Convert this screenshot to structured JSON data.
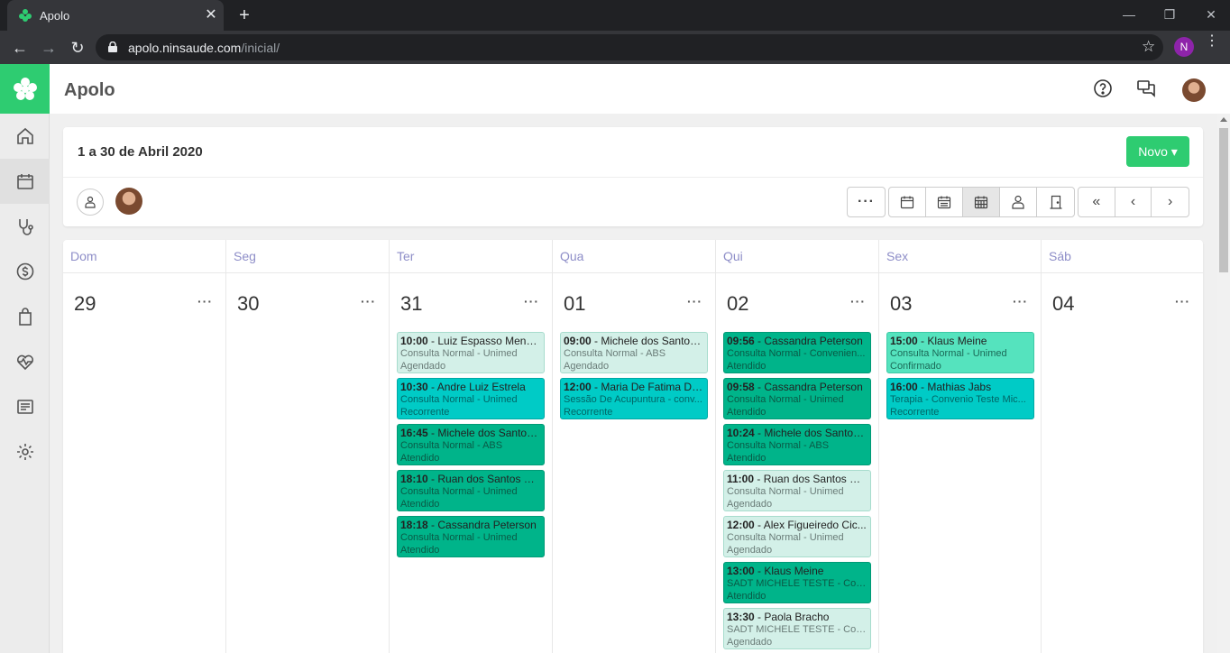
{
  "browser": {
    "tab_title": "Apolo",
    "url_host": "apolo.ninsaude.com",
    "url_path": "/inicial/",
    "profile_initial": "N"
  },
  "app": {
    "name": "Apolo",
    "brand_color": "#2ecc71"
  },
  "sidebar": {
    "items": [
      {
        "icon": "home-icon",
        "active": false
      },
      {
        "icon": "calendar-icon",
        "active": true
      },
      {
        "icon": "stethoscope-icon",
        "active": false
      },
      {
        "icon": "dollar-icon",
        "active": false
      },
      {
        "icon": "bag-icon",
        "active": false
      },
      {
        "icon": "heartbeat-icon",
        "active": false
      },
      {
        "icon": "report-icon",
        "active": false
      },
      {
        "icon": "gear-icon",
        "active": false
      }
    ]
  },
  "header": {
    "period": "1 a 30 de Abril 2020",
    "new_button": "Novo ▾"
  },
  "calendar": {
    "days": [
      {
        "dow": "Dom",
        "num": "29",
        "events": []
      },
      {
        "dow": "Seg",
        "num": "30",
        "events": []
      },
      {
        "dow": "Ter",
        "num": "31",
        "events": [
          {
            "time": "10:00",
            "name": "Luiz Espasso Mendes",
            "service": "Consulta Normal - Unimed",
            "status": "Agendado",
            "kind": "agendado"
          },
          {
            "time": "10:30",
            "name": "Andre Luiz Estrela",
            "service": "Consulta Normal - Unimed",
            "status": "Recorrente",
            "kind": "recorrente"
          },
          {
            "time": "16:45",
            "name": "Michele dos Santos ...",
            "service": "Consulta Normal - ABS",
            "status": "Atendido",
            "kind": "atendido"
          },
          {
            "time": "18:10",
            "name": "Ruan dos Santos M...",
            "service": "Consulta Normal - Unimed",
            "status": "Atendido",
            "kind": "atendido"
          },
          {
            "time": "18:18",
            "name": "Cassandra Peterson",
            "service": "Consulta Normal - Unimed",
            "status": "Atendido",
            "kind": "atendido"
          }
        ]
      },
      {
        "dow": "Qua",
        "num": "01",
        "events": [
          {
            "time": "09:00",
            "name": "Michele dos Santos ...",
            "service": "Consulta Normal - ABS",
            "status": "Agendado",
            "kind": "agendado"
          },
          {
            "time": "12:00",
            "name": "Maria De Fatima Da ...",
            "service": "Sessão De Acupuntura - conv...",
            "status": "Recorrente",
            "kind": "recorrente"
          }
        ]
      },
      {
        "dow": "Qui",
        "num": "02",
        "events": [
          {
            "time": "09:56",
            "name": "Cassandra Peterson",
            "service": "Consulta Normal - Convenien...",
            "status": "Atendido",
            "kind": "atendido"
          },
          {
            "time": "09:58",
            "name": "Cassandra Peterson",
            "service": "Consulta Normal - Unimed",
            "status": "Atendido",
            "kind": "atendido"
          },
          {
            "time": "10:24",
            "name": "Michele dos Santos...",
            "service": "Consulta Normal - ABS",
            "status": "Atendido",
            "kind": "atendido"
          },
          {
            "time": "11:00",
            "name": "Ruan dos Santos M...",
            "service": "Consulta Normal - Unimed",
            "status": "Agendado",
            "kind": "agendado"
          },
          {
            "time": "12:00",
            "name": "Alex Figueiredo Cic...",
            "service": "Consulta Normal - Unimed",
            "status": "Agendado",
            "kind": "agendado"
          },
          {
            "time": "13:00",
            "name": "Klaus Meine",
            "service": "SADT MICHELE TESTE - Con...",
            "status": "Atendido",
            "kind": "atendido"
          },
          {
            "time": "13:30",
            "name": "Paola Bracho",
            "service": "SADT MICHELE TESTE - Con...",
            "status": "Agendado",
            "kind": "agendado"
          }
        ]
      },
      {
        "dow": "Sex",
        "num": "03",
        "events": [
          {
            "time": "15:00",
            "name": "Klaus Meine",
            "service": "Consulta Normal - Unimed",
            "status": "Confirmado",
            "kind": "confirmado"
          },
          {
            "time": "16:00",
            "name": "Mathias Jabs",
            "service": "Terapia - Convenio Teste Mic...",
            "status": "Recorrente",
            "kind": "recorrente"
          }
        ]
      },
      {
        "dow": "Sáb",
        "num": "04",
        "events": []
      }
    ]
  }
}
